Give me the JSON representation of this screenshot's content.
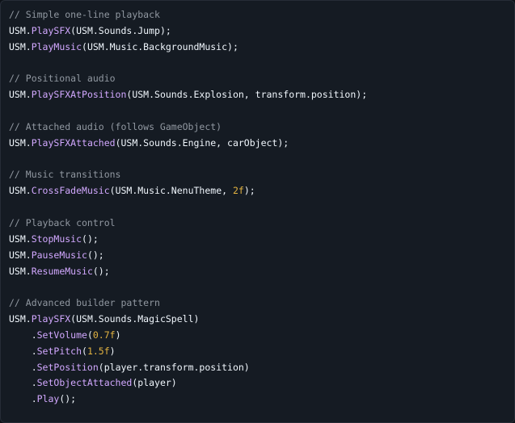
{
  "lines": [
    [
      {
        "t": "comment",
        "v": "// Simple one-line playback"
      }
    ],
    [
      {
        "t": "plain",
        "v": "USM."
      },
      {
        "t": "fn",
        "v": "PlaySFX"
      },
      {
        "t": "plain",
        "v": "(USM.Sounds.Jump);"
      }
    ],
    [
      {
        "t": "plain",
        "v": "USM."
      },
      {
        "t": "fn",
        "v": "PlayMusic"
      },
      {
        "t": "plain",
        "v": "(USM.Music.BackgroundMusic);"
      }
    ],
    [],
    [
      {
        "t": "comment",
        "v": "// Positional audio"
      }
    ],
    [
      {
        "t": "plain",
        "v": "USM."
      },
      {
        "t": "fn",
        "v": "PlaySFXAtPosition"
      },
      {
        "t": "plain",
        "v": "(USM.Sounds.Explosion, transform.position);"
      }
    ],
    [],
    [
      {
        "t": "comment",
        "v": "// Attached audio (follows GameObject)"
      }
    ],
    [
      {
        "t": "plain",
        "v": "USM."
      },
      {
        "t": "fn",
        "v": "PlaySFXAttached"
      },
      {
        "t": "plain",
        "v": "(USM.Sounds.Engine, carObject);"
      }
    ],
    [],
    [
      {
        "t": "comment",
        "v": "// Music transitions"
      }
    ],
    [
      {
        "t": "plain",
        "v": "USM."
      },
      {
        "t": "fn",
        "v": "CrossFadeMusic"
      },
      {
        "t": "plain",
        "v": "(USM.Music.NenuTheme, "
      },
      {
        "t": "num",
        "v": "2f"
      },
      {
        "t": "plain",
        "v": ");"
      }
    ],
    [],
    [
      {
        "t": "comment",
        "v": "// Playback control"
      }
    ],
    [
      {
        "t": "plain",
        "v": "USM."
      },
      {
        "t": "fn",
        "v": "StopMusic"
      },
      {
        "t": "plain",
        "v": "();"
      }
    ],
    [
      {
        "t": "plain",
        "v": "USM."
      },
      {
        "t": "fn",
        "v": "PauseMusic"
      },
      {
        "t": "plain",
        "v": "();"
      }
    ],
    [
      {
        "t": "plain",
        "v": "USM."
      },
      {
        "t": "fn",
        "v": "ResumeMusic"
      },
      {
        "t": "plain",
        "v": "();"
      }
    ],
    [],
    [
      {
        "t": "comment",
        "v": "// Advanced builder pattern"
      }
    ],
    [
      {
        "t": "plain",
        "v": "USM."
      },
      {
        "t": "fn",
        "v": "PlaySFX"
      },
      {
        "t": "plain",
        "v": "(USM.Sounds.MagicSpell)"
      }
    ],
    [
      {
        "t": "plain",
        "v": "    ."
      },
      {
        "t": "fn",
        "v": "SetVolume"
      },
      {
        "t": "plain",
        "v": "("
      },
      {
        "t": "num",
        "v": "0.7f"
      },
      {
        "t": "plain",
        "v": ")"
      }
    ],
    [
      {
        "t": "plain",
        "v": "    ."
      },
      {
        "t": "fn",
        "v": "SetPitch"
      },
      {
        "t": "plain",
        "v": "("
      },
      {
        "t": "num",
        "v": "1.5f"
      },
      {
        "t": "plain",
        "v": ")"
      }
    ],
    [
      {
        "t": "plain",
        "v": "    ."
      },
      {
        "t": "fn",
        "v": "SetPosition"
      },
      {
        "t": "plain",
        "v": "(player.transform.position)"
      }
    ],
    [
      {
        "t": "plain",
        "v": "    ."
      },
      {
        "t": "fn",
        "v": "SetObjectAttached"
      },
      {
        "t": "plain",
        "v": "(player)"
      }
    ],
    [
      {
        "t": "plain",
        "v": "    ."
      },
      {
        "t": "fn",
        "v": "Play"
      },
      {
        "t": "plain",
        "v": "();"
      }
    ]
  ],
  "colors": {
    "background": "#151b23",
    "comment": "#9198a1",
    "function": "#d2a8ff",
    "number": "#e3b341",
    "plain": "#f0f6fc"
  }
}
